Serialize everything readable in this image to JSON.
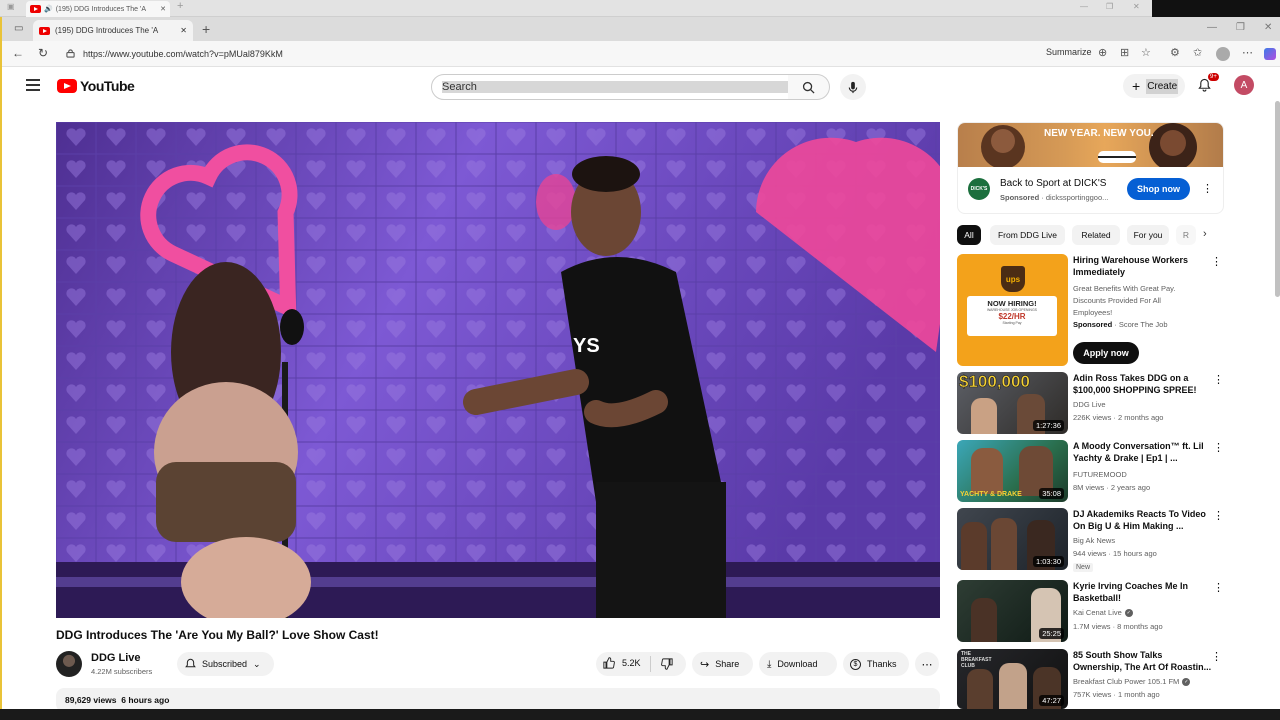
{
  "background_window": {
    "tab_title": "(195) DDG Introduces The 'A"
  },
  "browser": {
    "tab_title": "(195) DDG Introduces The 'A",
    "url": "https://www.youtube.com/watch?v=pMUal879KkM",
    "summarize_label": "Summarize"
  },
  "header": {
    "logo_text": "YouTube",
    "search_placeholder": "Search",
    "create_label": "Create",
    "notif_badge": "9+",
    "avatar_letter": "A"
  },
  "video": {
    "title": "DDG Introduces The 'Are You My Ball?' Love Show Cast!",
    "channel_name": "DDG Live",
    "subscribers": "4.22M subscribers",
    "subscribed_label": "Subscribed",
    "likes": "5.2K",
    "share_label": "Share",
    "download_label": "Download",
    "thanks_label": "Thanks",
    "views": "89,629 views",
    "age": "6 hours ago"
  },
  "ad": {
    "banner_text": "NEW YEAR. NEW YOU.",
    "logo_text": "DICK'S",
    "title": "Back to Sport at DICK'S",
    "sponsored": "Sponsored",
    "domain": "dickssportinggoo...",
    "cta": "Shop now"
  },
  "chips": [
    "All",
    "From DDG Live",
    "Related",
    "For you",
    "R"
  ],
  "sponsored_video": {
    "title": "Hiring Warehouse Workers Immediately",
    "desc": "Great Benefits With Great Pay. Discounts Provided For All Employees!",
    "sponsored": "Sponsored",
    "advertiser": "Score The Job",
    "cta": "Apply now",
    "thumb_logo": "ups",
    "thumb_heading": "NOW HIRING!",
    "thumb_sub": "WAREHOUSE JOB OPENINGS",
    "thumb_pay": "$22/HR",
    "thumb_small": "Starting Pay"
  },
  "related": [
    {
      "title": "Adin Ross Takes DDG on a $100,000 SHOPPING SPREE!",
      "channel": "DDG Live",
      "meta": "226K views · 2 months ago",
      "duration": "1:27:36",
      "overlay": "$100,000"
    },
    {
      "title": "A Moody Conversation™ ft. Lil Yachty & Drake | Ep1 | ...",
      "channel": "FUTUREMOOD",
      "meta": "8M views · 2 years ago",
      "duration": "35:08",
      "overlay": "YACHTY & DRAKE"
    },
    {
      "title": "DJ Akademiks Reacts To Video On Big U & Him Making ...",
      "channel": "Big Ak News",
      "meta": "944 views · 15 hours ago",
      "duration": "1:03:30",
      "badge": "New"
    },
    {
      "title": "Kyrie Irving Coaches Me In Basketball!",
      "channel": "Kai Cenat Live",
      "meta": "1.7M views · 8 months ago",
      "duration": "25:25"
    },
    {
      "title": "85 South Show Talks Ownership, The Art Of Roastin...",
      "channel": "Breakfast Club Power 105.1 FM",
      "meta": "757K views · 1 month ago",
      "duration": "47:27",
      "overlay": "THE BREAKFAST CLUB"
    }
  ]
}
